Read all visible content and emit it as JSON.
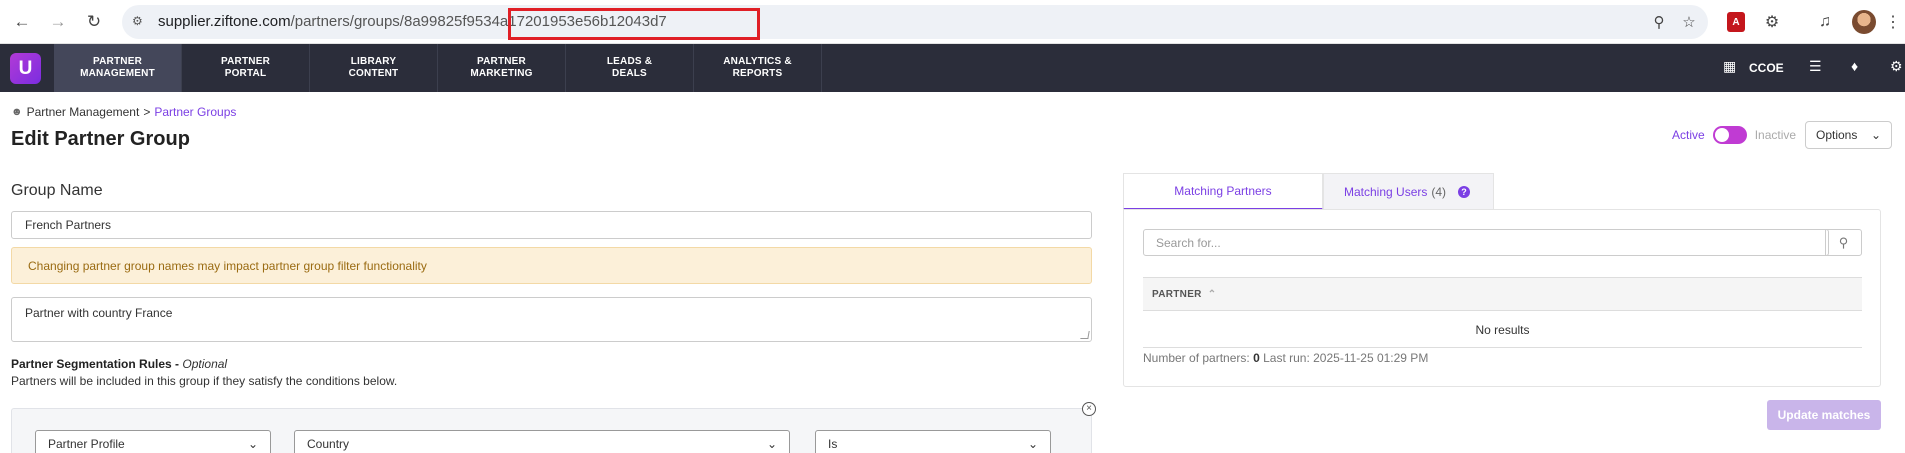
{
  "browser": {
    "url_host": "supplier.ziftone.com",
    "url_path": "/partners/groups/",
    "url_id": "8a99825f9534a17201953e56b12043d7"
  },
  "appnav": {
    "logo": "U",
    "items": [
      {
        "label": "PARTNER\nMANAGEMENT"
      },
      {
        "label": "PARTNER\nPORTAL"
      },
      {
        "label": "LIBRARY\nCONTENT"
      },
      {
        "label": "PARTNER\nMARKETING"
      },
      {
        "label": "LEADS &\nDEALS"
      },
      {
        "label": "ANALYTICS &\nREPORTS"
      }
    ],
    "org_label": "CCOE"
  },
  "breadcrumb": {
    "root": "Partner Management",
    "separator": ">",
    "current": "Partner Groups"
  },
  "page": {
    "title": "Edit Partner Group",
    "status_active": "Active",
    "status_inactive": "Inactive",
    "options_label": "Options"
  },
  "form": {
    "group_name_label": "Group Name",
    "group_name_value": "French Partners",
    "warning": "Changing partner group names may impact partner group filter functionality",
    "description_value": "Partner with country France",
    "rules_title": "Partner Segmentation Rules",
    "rules_optional": "Optional",
    "rules_desc": "Partners will be included in this group if they satisfy the conditions below.",
    "rule": {
      "source": "Partner Profile",
      "field": "Country",
      "operator": "Is"
    }
  },
  "matching": {
    "tab_partners": "Matching Partners",
    "tab_users": "Matching Users",
    "tab_users_count": "(4)",
    "search_placeholder": "Search for...",
    "column_partner": "PARTNER",
    "empty": "No results",
    "footer_label": "Number of partners:",
    "footer_count": "0",
    "footer_last_run": "Last run: 2025-11-25 01:29 PM",
    "update_button": "Update matches"
  },
  "colors": {
    "accent": "#7b3fe4",
    "nav_bg": "#2b2d3a",
    "highlight": "#e01f26"
  }
}
